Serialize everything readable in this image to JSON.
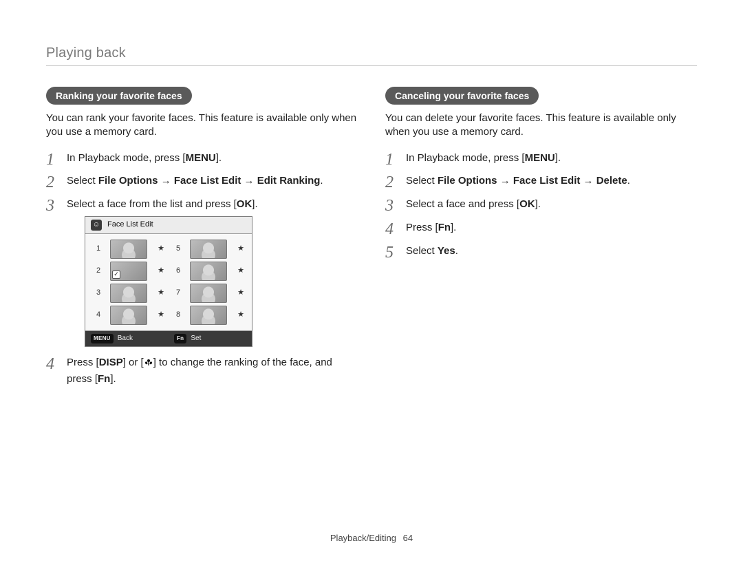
{
  "header": {
    "section_title": "Playing back"
  },
  "left": {
    "pill": "Ranking your favorite faces",
    "intro": "You can rank your favorite faces. This feature is available only when you use a memory card.",
    "steps": {
      "s1_pre": "In Playback mode, press [",
      "s1_key": "MENU",
      "s1_post": "].",
      "s2_pre": "Select ",
      "s2_bold": "File Options → Face List Edit → Edit Ranking",
      "s2_post": ".",
      "s3_pre": "Select a face from the list and press [",
      "s3_key": "OK",
      "s3_post": "].",
      "s4_pre": "Press [",
      "s4_key1": "DISP",
      "s4_mid": "] or [",
      "s4_key2_icon_name": "macro-icon",
      "s4_post1": "] to change the ranking of the face, and press [",
      "s4_key3": "Fn",
      "s4_post2": "]."
    },
    "device": {
      "title": "Face List Edit",
      "rows": [
        {
          "n": "1",
          "star": "★"
        },
        {
          "n": "2",
          "star": "★",
          "selected": true,
          "checked": true
        },
        {
          "n": "3",
          "star": "★"
        },
        {
          "n": "4",
          "star": "★"
        },
        {
          "n": "5",
          "star": "★"
        },
        {
          "n": "6",
          "star": "★"
        },
        {
          "n": "7",
          "star": "★"
        },
        {
          "n": "8",
          "star": "★"
        }
      ],
      "footer": {
        "back_tag": "MENU",
        "back_label": "Back",
        "set_tag": "Fn",
        "set_label": "Set"
      }
    }
  },
  "right": {
    "pill": "Canceling your favorite faces",
    "intro": "You can delete your favorite faces. This feature is available only when you use a memory card.",
    "steps": {
      "s1_pre": "In Playback mode, press [",
      "s1_key": "MENU",
      "s1_post": "].",
      "s2_pre": "Select ",
      "s2_bold": "File Options → Face List Edit → Delete",
      "s2_post": ".",
      "s3_pre": "Select a face and press [",
      "s3_key": "OK",
      "s3_post": "].",
      "s4_pre": "Press [",
      "s4_key": "Fn",
      "s4_post": "].",
      "s5_pre": "Select ",
      "s5_bold": "Yes",
      "s5_post": "."
    }
  },
  "footer": {
    "label": "Playback/Editing",
    "page": "64"
  }
}
